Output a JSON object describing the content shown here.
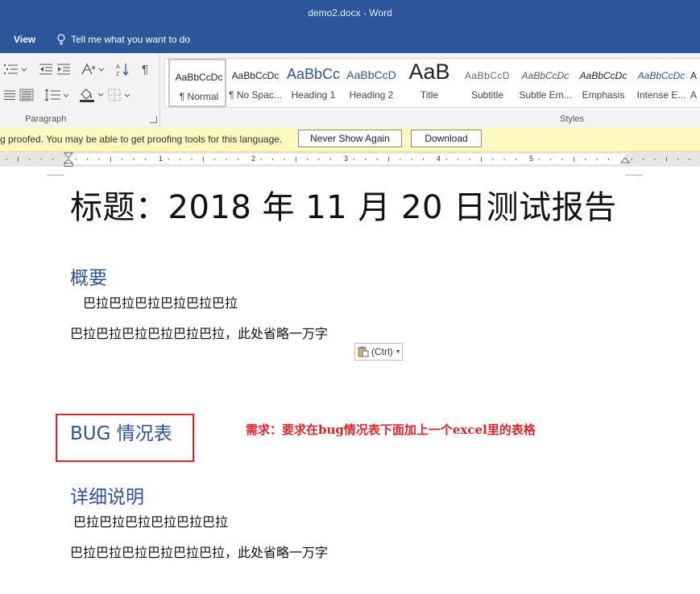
{
  "window": {
    "title": "demo2.docx  -  Word"
  },
  "tabs": {
    "view": "View",
    "tell_me": "Tell me what you want to do"
  },
  "ribbon": {
    "paragraph_label": "Paragraph",
    "styles_label": "Styles",
    "styles": [
      {
        "sample": "AaBbCcDc",
        "name": "¶ Normal"
      },
      {
        "sample": "AaBbCcDc",
        "name": "¶ No Spac..."
      },
      {
        "sample": "AaBbCc",
        "name": "Heading 1"
      },
      {
        "sample": "AaBbCcD",
        "name": "Heading 2"
      },
      {
        "sample": "AaB",
        "name": "Title"
      },
      {
        "sample": "AaBbCcD",
        "name": "Subtitle"
      },
      {
        "sample": "AaBbCcDc",
        "name": "Subtle Em..."
      },
      {
        "sample": "AaBbCcDc",
        "name": "Emphasis"
      },
      {
        "sample": "AaBbCcDc",
        "name": "Intense E..."
      },
      {
        "sample": "A",
        "name": "A"
      }
    ]
  },
  "message_bar": {
    "text": "g proofed. You may be able to get proofing tools for this language.",
    "never_show": "Never Show Again",
    "download": "Download"
  },
  "ruler": {
    "numbers": [
      "1",
      "2",
      "3",
      "4",
      "5"
    ]
  },
  "document": {
    "title": "标题：2018 年 11 月 20 日测试报告",
    "h_summary": "概要",
    "summary_p1": "巴拉巴拉巴拉巴拉巴拉巴拉",
    "summary_p2": "巴拉巴拉巴拉巴拉巴拉巴拉，此处省略一万字",
    "paste_ctrl": "(Ctrl)",
    "h_bug": "BUG 情况表",
    "annotation": "需求：要求在bug情况表下面加上一个excel里的表格",
    "h_detail": "详细说明",
    "detail_p1": "巴拉巴拉巴拉巴拉巴拉巴拉",
    "detail_p2": "巴拉巴拉巴拉巴拉巴拉巴拉，此处省略一万字"
  },
  "colors": {
    "accent": "#2b579a",
    "heading": "#2f5496",
    "annotation": "#d9262b",
    "message_bar": "#fcf8c0"
  }
}
